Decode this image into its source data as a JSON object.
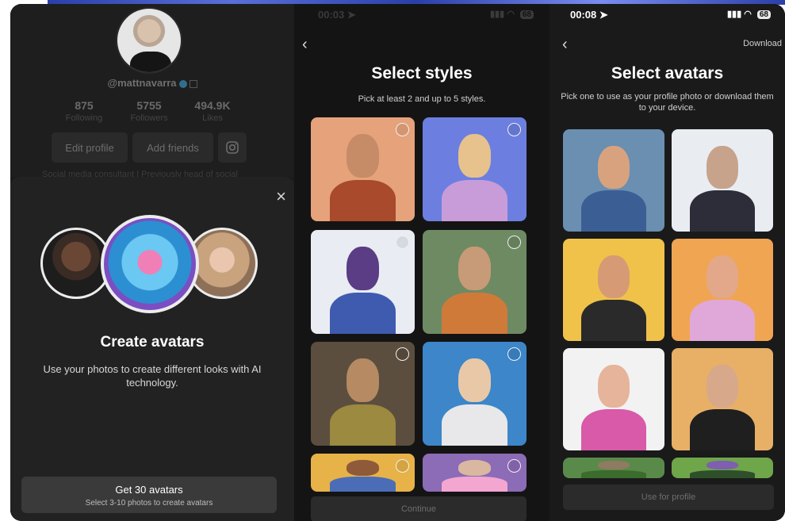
{
  "left_panel": {
    "profile": {
      "username": "@mattnavarra",
      "stats": [
        {
          "value": "875",
          "label": "Following"
        },
        {
          "value": "5755",
          "label": "Followers"
        },
        {
          "value": "494.9K",
          "label": "Likes"
        }
      ],
      "edit_profile": "Edit profile",
      "add_friends": "Add friends",
      "bio": "Social media consultant | Previously head of social"
    },
    "sheet": {
      "close_icon": "×",
      "title": "Create avatars",
      "description": "Use your photos to create different looks with AI technology.",
      "cta_title": "Get 30 avatars",
      "cta_subtitle": "Select 3-10 photos to create avatars"
    }
  },
  "middle_panel": {
    "status": {
      "time": "00:03",
      "battery": "68"
    },
    "title": "Select styles",
    "subtitle": "Pick at least 2 and up to 5 styles.",
    "continue_label": "Continue",
    "styles": [
      {
        "name": "style-1",
        "bg": "#e6a27b",
        "face": "#c68b67",
        "body": "#a84a2b"
      },
      {
        "name": "style-2",
        "bg": "#6c7fe0",
        "face": "#e7c28c",
        "body": "#c89cd8"
      },
      {
        "name": "style-3",
        "bg": "#e9ecf2",
        "face": "#5a3d85",
        "body": "#3e5bb0"
      },
      {
        "name": "style-4",
        "bg": "#6e8a63",
        "face": "#c79b78",
        "body": "#d07a3a"
      },
      {
        "name": "style-5",
        "bg": "#5b4e3e",
        "face": "#b68a62",
        "body": "#9b8a3f"
      },
      {
        "name": "style-6",
        "bg": "#3c86c9",
        "face": "#e9c8a8",
        "body": "#e8e8ea"
      },
      {
        "name": "style-7",
        "bg": "#e7b247",
        "face": "#8e5a3a",
        "body": "#4b6db8"
      },
      {
        "name": "style-8",
        "bg": "#8c6bb7",
        "face": "#d9b7a0",
        "body": "#f2a6d0"
      }
    ]
  },
  "right_panel": {
    "status": {
      "time": "00:08",
      "battery": "68"
    },
    "download_label": "Download",
    "title": "Select avatars",
    "subtitle": "Pick one to use as your profile photo or download them to your device.",
    "use_for_profile": "Use for profile",
    "avatars": [
      {
        "bg": "#6a8fb0",
        "face": "#d9a27f",
        "body": "#3b5f95"
      },
      {
        "bg": "#e9edf2",
        "face": "#c7a38c",
        "body": "#2d2d3a"
      },
      {
        "bg": "#f0c24a",
        "face": "#d69b74",
        "body": "#2a2a2a"
      },
      {
        "bg": "#f0a552",
        "face": "#e3a889",
        "body": "#e0a8d8"
      },
      {
        "bg": "#f2f2f2",
        "face": "#e6b49a",
        "body": "#d85aa8"
      },
      {
        "bg": "#e8b066",
        "face": "#d7a88a",
        "body": "#1f1f1f"
      },
      {
        "bg": "#5a8a4a",
        "face": "#8f7a62",
        "body": "#3c6b2e"
      },
      {
        "bg": "#6fa64a",
        "face": "#7e5fb0",
        "body": "#2e4f2a"
      }
    ]
  }
}
